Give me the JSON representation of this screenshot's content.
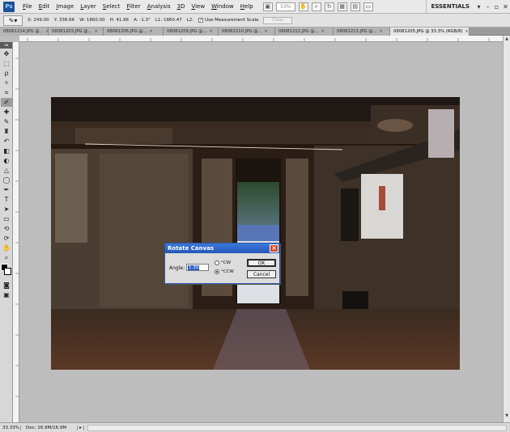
{
  "app": {
    "logo": "Ps",
    "workspace": "ESSENTIALS",
    "zoom_field": "33%"
  },
  "menu": [
    {
      "label": "File",
      "u": "F",
      "rest": "ile"
    },
    {
      "label": "Edit",
      "u": "E",
      "rest": "dit"
    },
    {
      "label": "Image",
      "u": "I",
      "rest": "mage"
    },
    {
      "label": "Layer",
      "u": "L",
      "rest": "ayer"
    },
    {
      "label": "Select",
      "u": "S",
      "rest": "elect"
    },
    {
      "label": "Filter",
      "u": "F",
      "rest": "ilter",
      "prefix": "Fil",
      "suffix": "ter"
    },
    {
      "label": "Analysis",
      "u": "A",
      "rest": "nalysis"
    },
    {
      "label": "3D",
      "u": "3",
      "rest": "D"
    },
    {
      "label": "View",
      "u": "V",
      "rest": "iew"
    },
    {
      "label": "Window",
      "u": "W",
      "rest": "indow"
    },
    {
      "label": "Help",
      "u": "H",
      "rest": "elp"
    }
  ],
  "options": {
    "x": "X: 249.00",
    "y": "Y: 338.66",
    "w": "W: 1860.00",
    "h": "H: 41.96",
    "a": "A: -1.3°",
    "l1": "L1: 1860.47",
    "l2": "L2:",
    "measurement_scale": "Use Measurement Scale",
    "clear": "Clear"
  },
  "tabs": [
    "08081214.JPG @...",
    "08081203.JPG @...",
    "08081206.JPG @...",
    "08081209.JPG @...",
    "08081210.JPG @...",
    "08081212.JPG @...",
    "08081213.JPG @...",
    "08081205.JPG @ 33.3% (RGB/8)"
  ],
  "status": {
    "zoom": "33.33%",
    "doc": "Doc: 16.9M/16.9M"
  },
  "dialog": {
    "title": "Rotate Canvas",
    "angle_label": "Angle:",
    "angle_value": "1.30",
    "cw_label": "°CW",
    "ccw_label": "°CCW",
    "ok_label": "OK",
    "cancel_label": "Cancel"
  }
}
